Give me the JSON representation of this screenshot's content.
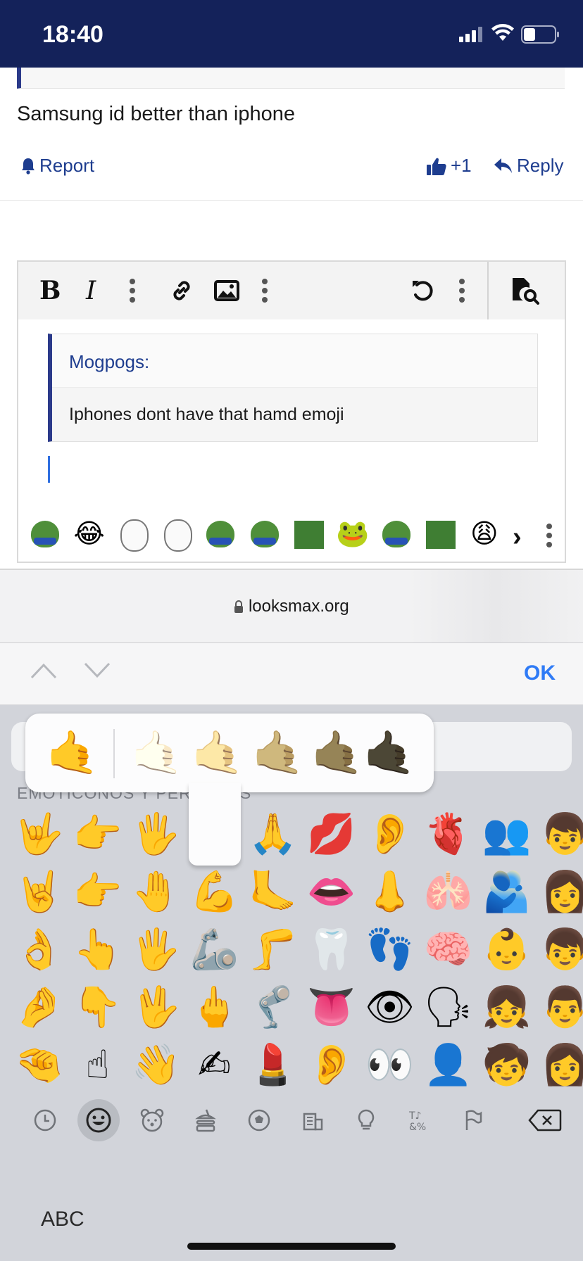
{
  "status_bar": {
    "time": "18:40"
  },
  "post": {
    "text": "Samsung id better than iphone",
    "report_label": "Report",
    "like_count": "+1",
    "reply_label": "Reply"
  },
  "editor": {
    "bold_label": "B",
    "italic_label": "I",
    "quote_author": "Mogpogs:",
    "quote_text": "Iphones dont have that hamd emoji",
    "smilies": [
      "pepe",
      "😂",
      "wojak",
      "wojak",
      "pepe",
      "pepe",
      "pepe",
      "🐸",
      "pepe",
      "pepe",
      "😩"
    ]
  },
  "browser": {
    "url": "looksmax.org"
  },
  "accessory": {
    "ok_label": "OK"
  },
  "keyboard": {
    "section_title": "EMOTICONOS Y PERSONAS",
    "skin_tone_popup": [
      "🤙",
      "🤙",
      "🤙",
      "🤙",
      "🤙",
      "🤙"
    ],
    "emoji_rows": [
      [
        "🤟",
        "👉",
        "🖐",
        "",
        "🙏",
        "💋",
        "👂",
        "🫀",
        "👥",
        "👦"
      ],
      [
        "🤘",
        "👉",
        "🤚",
        "💪",
        "🦶",
        "👄",
        "👃",
        "🫁",
        "🫂",
        "👩"
      ],
      [
        "👌",
        "👆",
        "🖐",
        "🦾",
        "🦵",
        "🦷",
        "👣",
        "🧠",
        "👶",
        "👦"
      ],
      [
        "🤌",
        "👇",
        "🖖",
        "🖕",
        "🦿",
        "👅",
        "👁",
        "🗣",
        "👧",
        "👨"
      ],
      [
        "🤏",
        "☝",
        "👋",
        "✍",
        "💄",
        "👂",
        "👀",
        "👤",
        "🧒",
        "👩"
      ]
    ],
    "abc_label": "ABC",
    "categories": [
      "recent",
      "smileys",
      "animals",
      "food",
      "activity",
      "travel",
      "objects",
      "symbols",
      "flags",
      "delete"
    ]
  }
}
